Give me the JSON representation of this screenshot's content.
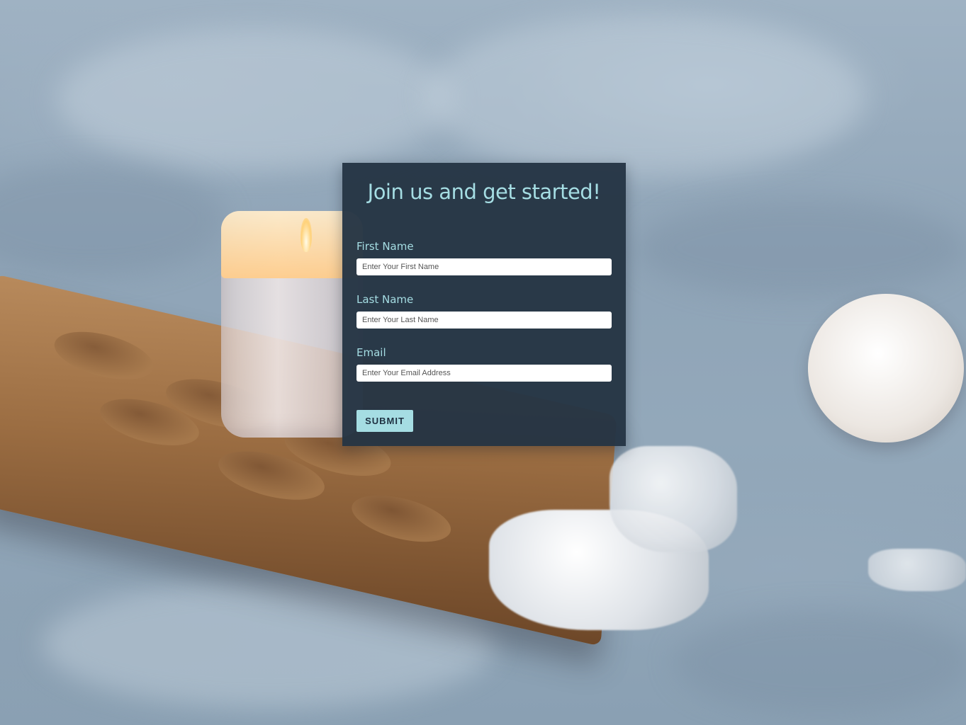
{
  "form": {
    "title": "Join us and get started!",
    "first_name": {
      "label": "First Name",
      "placeholder": "Enter Your First Name",
      "value": ""
    },
    "last_name": {
      "label": "Last Name",
      "placeholder": "Enter Your Last Name",
      "value": ""
    },
    "email": {
      "label": "Email",
      "placeholder": "Enter Your Email Address",
      "value": ""
    },
    "submit_label": "SUBMIT"
  },
  "colors": {
    "card_background": "#243444",
    "accent": "#a5dde3",
    "button_text": "#1f3142",
    "input_background": "#ffffff"
  },
  "background": {
    "objects": [
      "bed-linen",
      "candle-jar",
      "wooden-tray",
      "cotton-flower",
      "quartz-crystals"
    ]
  }
}
